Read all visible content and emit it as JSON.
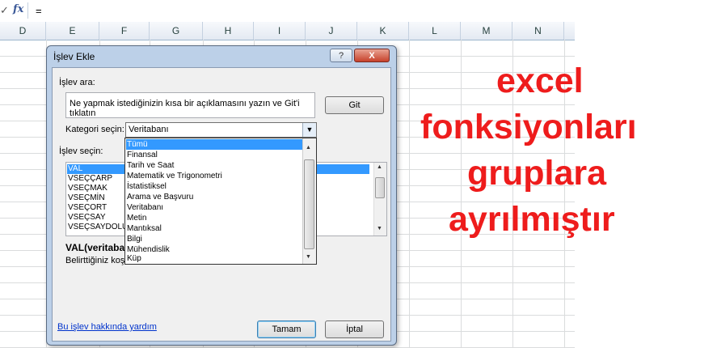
{
  "formula_bar": {
    "check_icon": "✓",
    "fx_label": "fx",
    "formula": "="
  },
  "columns": [
    "D",
    "E",
    "F",
    "G",
    "H",
    "I",
    "J",
    "K",
    "L",
    "M",
    "N"
  ],
  "dialog": {
    "title": "İşlev Ekle",
    "help_button": "?",
    "close_button": "X",
    "search_label": "İşlev ara:",
    "search_text": "Ne yapmak istediğinizin kısa bir açıklamasını yazın ve Git'i tıklatın",
    "go_button": "Git",
    "category_label": "Kategori seçin:",
    "category_value": "Veritabanı",
    "function_label": "İşlev seçin:",
    "functions": [
      "VAL",
      "VSEÇÇARP",
      "VSEÇMAK",
      "VSEÇMİN",
      "VSEÇORT",
      "VSEÇSAY",
      "VSEÇSAYDOLU"
    ],
    "selected_function": "VAL",
    "syntax": "VAL(veritaba",
    "description": "Belirttiğiniz koşu",
    "category_options": [
      "Tümü",
      "Finansal",
      "Tarih ve Saat",
      "Matematik ve Trigonometri",
      "İstatistiksel",
      "Arama ve Başvuru",
      "Veritabanı",
      "Metin",
      "Mantıksal",
      "Bilgi",
      "Mühendislik",
      "Küp"
    ],
    "highlighted_option": "Tümü",
    "help_link": "Bu işlev hakkında yardım",
    "ok_button": "Tamam",
    "cancel_button": "İptal"
  },
  "headline": [
    "excel",
    "fonksiyonları",
    "gruplara",
    "ayrılmıştır"
  ],
  "colors": {
    "headline": "#ee1c1c",
    "selection": "#3399ff"
  }
}
